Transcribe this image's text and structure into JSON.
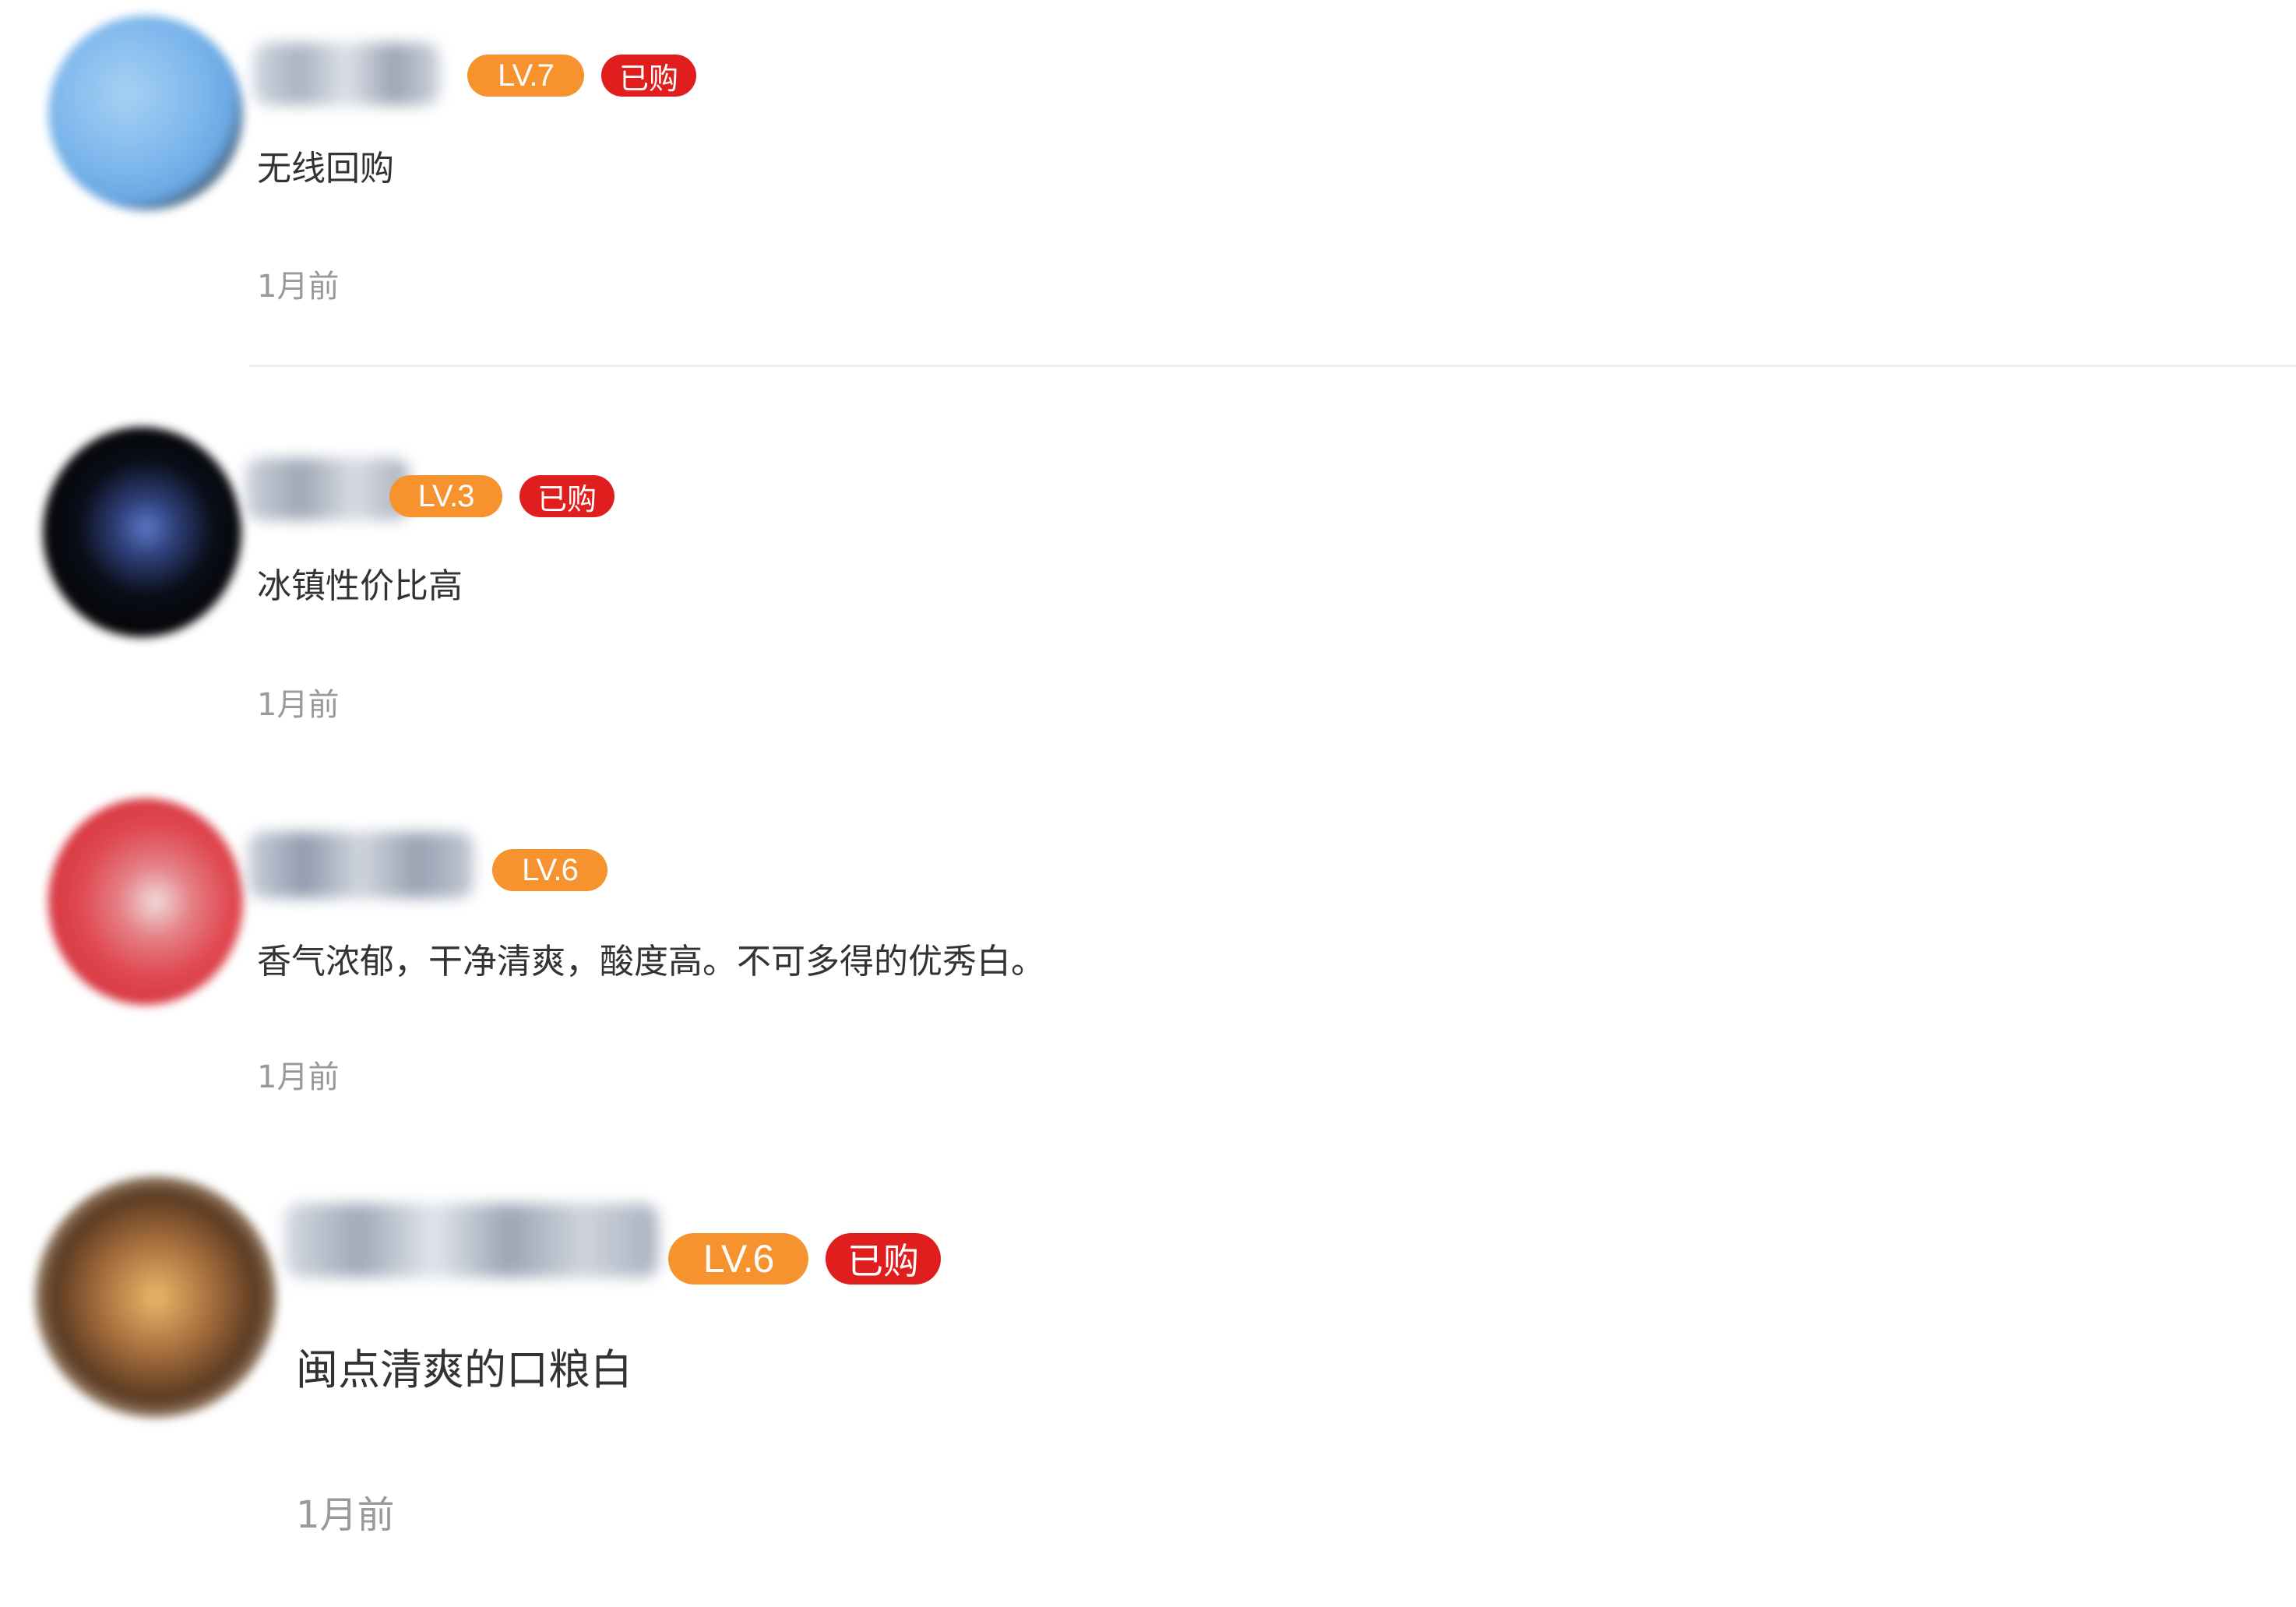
{
  "comments": [
    {
      "level": "LV.7",
      "purchased_label": "已购",
      "text": "无线回购",
      "time": "1月前"
    },
    {
      "level": "LV.3",
      "purchased_label": "已购",
      "text": "冰镇性价比高",
      "time": "1月前"
    },
    {
      "level": "LV.6",
      "text": "香气浓郁，干净清爽，酸度高。不可多得的优秀白。",
      "time": "1月前"
    },
    {
      "level": "LV.6",
      "purchased_label": "已购",
      "text": "闽点清爽的口粮白",
      "time": "1月前"
    }
  ],
  "colors": {
    "level_badge": "#f7932e",
    "purchased_badge": "#e01e1e",
    "comment_text": "#333333",
    "time_text": "#999999",
    "divider": "#eeeeee"
  }
}
